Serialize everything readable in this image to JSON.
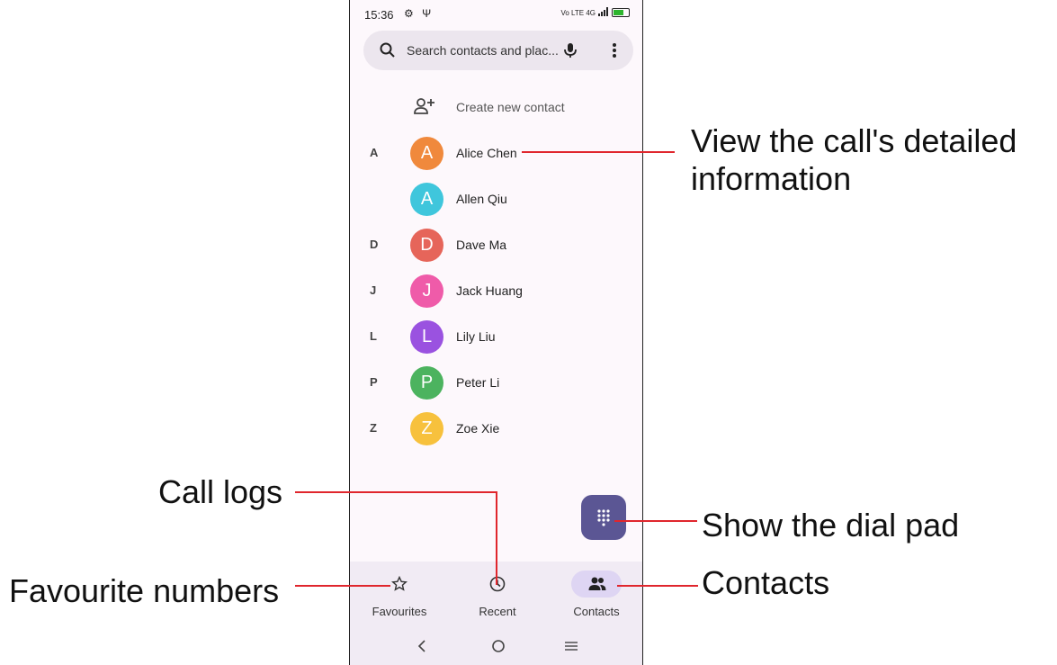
{
  "status": {
    "time": "15:36",
    "left_icons": "⚙ Ψ",
    "network": "Vo LTE 4G"
  },
  "search": {
    "placeholder": "Search contacts and plac..."
  },
  "create_contact": {
    "label": "Create new contact"
  },
  "contacts": [
    {
      "letter": "A",
      "initial": "A",
      "name": "Alice Chen",
      "color": "#f0893c"
    },
    {
      "letter": "",
      "initial": "A",
      "name": "Allen Qiu",
      "color": "#3fc6dc"
    },
    {
      "letter": "D",
      "initial": "D",
      "name": "Dave Ma",
      "color": "#e6655a"
    },
    {
      "letter": "J",
      "initial": "J",
      "name": "Jack Huang",
      "color": "#ef5ba9"
    },
    {
      "letter": "L",
      "initial": "L",
      "name": "Lily Liu",
      "color": "#9a52e0"
    },
    {
      "letter": "P",
      "initial": "P",
      "name": "Peter Li",
      "color": "#4cb35f"
    },
    {
      "letter": "Z",
      "initial": "Z",
      "name": "Zoe Xie",
      "color": "#f7c13d"
    }
  ],
  "nav": {
    "favourites_label": "Favourites",
    "recent_label": "Recent",
    "contacts_label": "Contacts"
  },
  "annotations": {
    "view_detail_line1": "View the call's detailed",
    "view_detail_line2": "information",
    "call_logs": "Call logs",
    "dial_pad": "Show the dial pad",
    "favourite_numbers": "Favourite numbers",
    "contacts": "Contacts"
  },
  "colors": {
    "accent": "#5b5694",
    "annotation_line": "#e0262d"
  }
}
